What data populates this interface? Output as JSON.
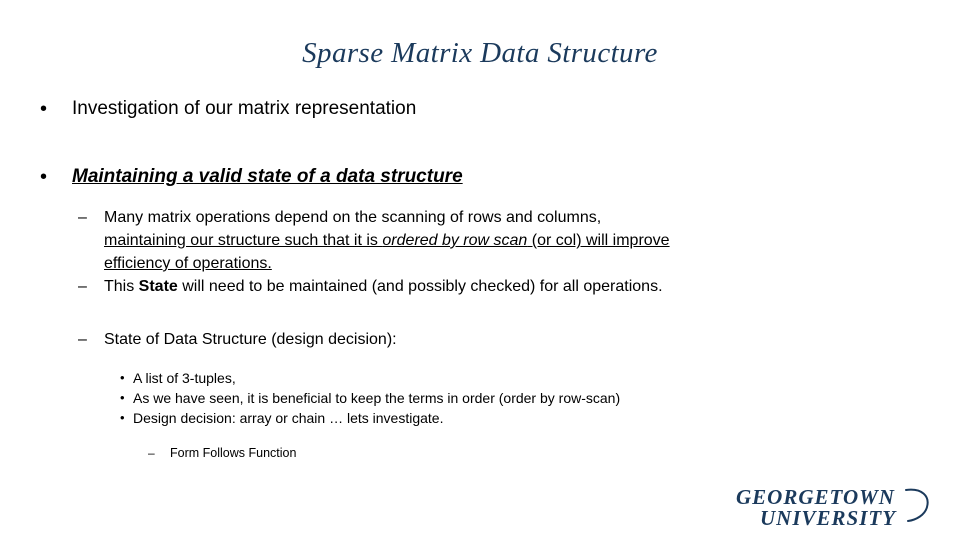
{
  "slide": {
    "title": "Sparse Matrix Data Structure",
    "background_color": "#ffffff",
    "accent_color": "#1b3a5c",
    "text_color": "#000000"
  },
  "content": {
    "bullet1": {
      "marker": "•",
      "text": "Investigation of our matrix representation"
    },
    "bullet2": {
      "marker": "•",
      "text": "Maintaining a valid state of a data structure"
    },
    "sub1": {
      "marker": "–",
      "line1": "Many matrix operations depend on the scanning of rows and columns,",
      "line2_a": "maintaining our structure such that it is ",
      "line2_italic": "ordered by row scan",
      "line2_b": " (or col) will improve",
      "line3": "efficiency of operations."
    },
    "sub2": {
      "marker": "–",
      "prefix": "This ",
      "bold": "State",
      "suffix": " will need to be maintained (and possibly checked) for all operations."
    },
    "sub3": {
      "marker": "–",
      "text": "State of Data Structure (design decision):"
    },
    "sub_sub": {
      "marker": "•",
      "items": [
        "A list of 3-tuples,",
        "As we have seen, it is beneficial to keep the terms in order (order by row-scan)",
        "Design decision: array or chain … lets investigate."
      ]
    },
    "sub_sub_sub": {
      "marker": "–",
      "text": "Form Follows Function"
    }
  },
  "logo": {
    "line1": "GEORGETOWN",
    "line2": "UNIVERSITY",
    "color": "#1b3a5c"
  }
}
